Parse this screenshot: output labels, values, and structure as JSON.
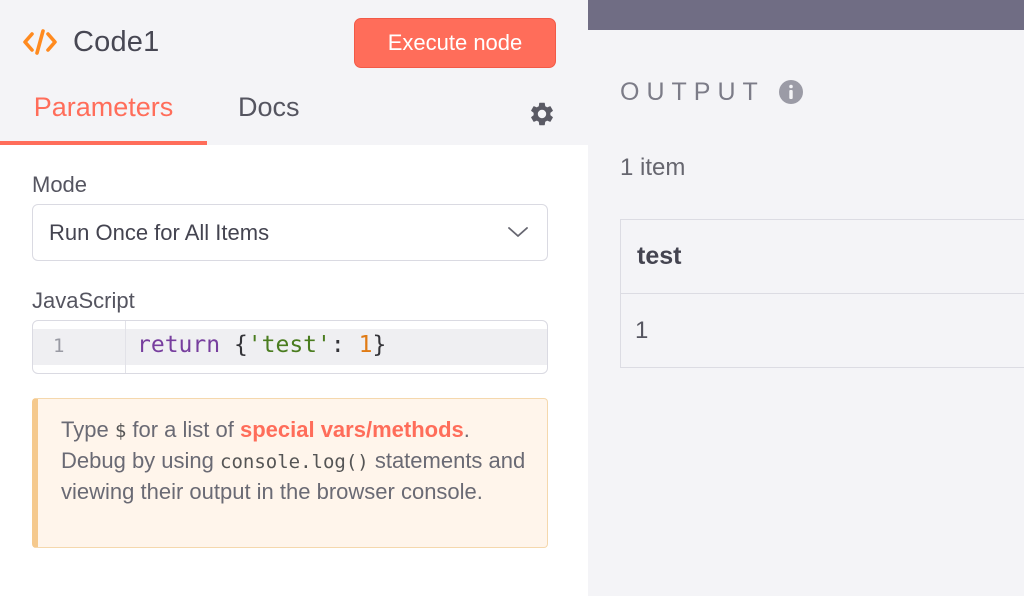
{
  "node": {
    "title": "Code1",
    "execute_label": "Execute node",
    "icon": "code-brackets-icon",
    "accent_color": "#ff6d5a"
  },
  "tabs": [
    {
      "label": "Parameters",
      "active": true
    },
    {
      "label": "Docs",
      "active": false
    }
  ],
  "params": {
    "mode_label": "Mode",
    "mode_value": "Run Once for All Items",
    "js_label": "JavaScript",
    "code": {
      "line_number": "1",
      "keyword": "return",
      "open": " {",
      "string": "'test'",
      "colon": ": ",
      "number": "1",
      "close": "}"
    }
  },
  "hint": {
    "prefix": "Type ",
    "dollar": "$",
    "middle": " for a list of ",
    "link": "special vars/methods",
    "after_link": ".",
    "debug_prefix": "Debug by using ",
    "console_code": "console.log()",
    "debug_suffix": " statements and viewing their output in the browser console."
  },
  "output": {
    "label": "OUTPUT",
    "item_count": "1 item",
    "columns": [
      "test"
    ],
    "rows": [
      [
        "1"
      ]
    ]
  }
}
